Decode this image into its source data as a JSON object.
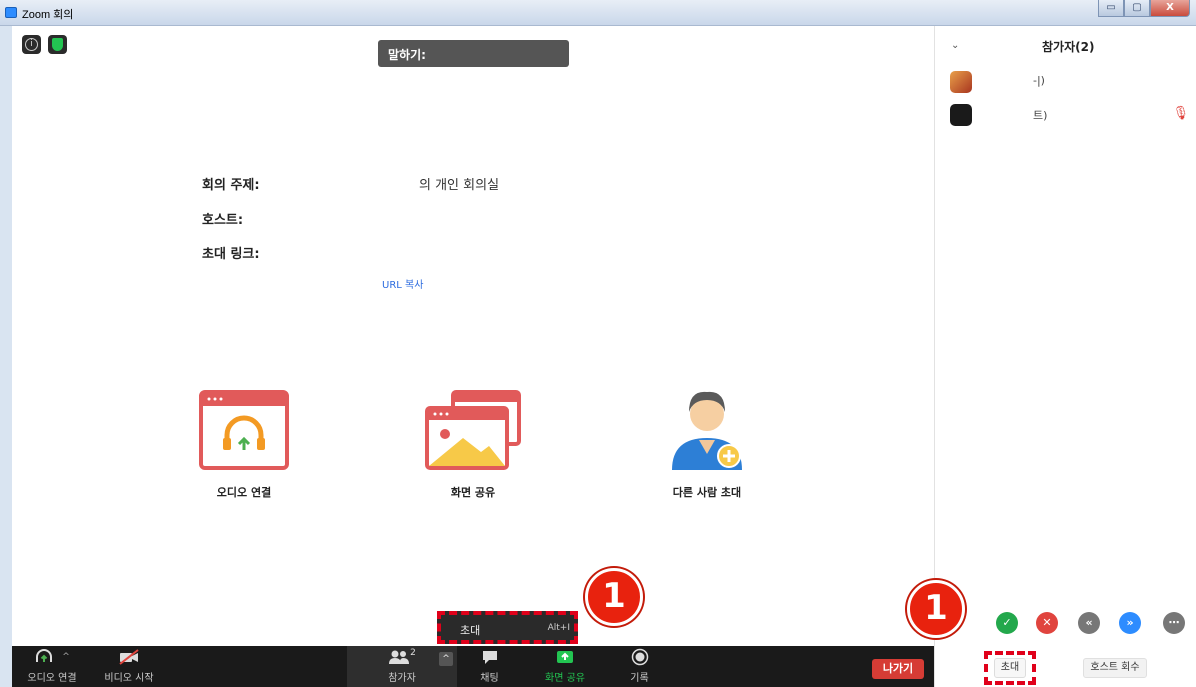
{
  "window": {
    "title": "Zoom 회의",
    "controls": [
      "▭",
      "▢",
      "X"
    ]
  },
  "meeting": {
    "speaking_label": "말하기:",
    "topic_label": "회의 주제:",
    "topic_value": "의 개인 회의실",
    "host_label": "호스트:",
    "invite_link_label": "초대 링크:",
    "copy_url": "URL 복사"
  },
  "actions": {
    "audio": "오디오 연결",
    "share": "화면 공유",
    "invite": "다른 사람 초대"
  },
  "toolbar": {
    "audio": "오디오 연결",
    "video": "비디오 시작",
    "participants": "참가자",
    "participants_count": "2",
    "chat": "채팅",
    "share": "화면 공유",
    "record": "기록",
    "leave": "나가기",
    "caret": "^"
  },
  "invite_popup": {
    "label": "초대",
    "shortcut": "Alt+I"
  },
  "callout_number": "1",
  "panel": {
    "title": "참가자(2)",
    "participants": [
      {
        "name": "-|)",
        "muted": false
      },
      {
        "name": "트)",
        "muted": true
      }
    ],
    "invite_button": "초대",
    "reclaim_host_button": "호스트 회수"
  },
  "colors": {
    "accent": "#2d8cff",
    "leave": "#d63c35",
    "highlight": "#e0001a",
    "share_green": "#23c552"
  }
}
